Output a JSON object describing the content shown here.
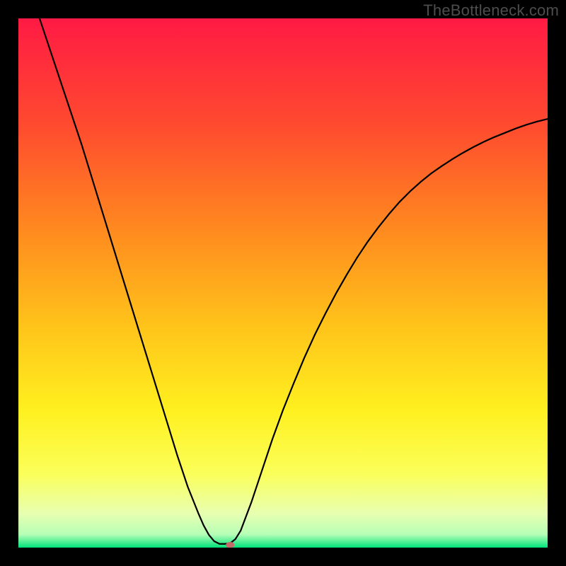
{
  "watermark": "TheBottleneck.com",
  "chart_data": {
    "type": "line",
    "title": "",
    "xlabel": "",
    "ylabel": "",
    "xlim": [
      0,
      100
    ],
    "ylim": [
      0,
      100
    ],
    "grid": false,
    "legend": false,
    "background_gradient_stops": [
      {
        "pos": 0.0,
        "color": "#ff1a44"
      },
      {
        "pos": 0.2,
        "color": "#ff4a2f"
      },
      {
        "pos": 0.4,
        "color": "#ff8a1f"
      },
      {
        "pos": 0.58,
        "color": "#ffc31a"
      },
      {
        "pos": 0.74,
        "color": "#fff01f"
      },
      {
        "pos": 0.86,
        "color": "#fbff5a"
      },
      {
        "pos": 0.935,
        "color": "#e8ffb0"
      },
      {
        "pos": 0.975,
        "color": "#b6ffb6"
      },
      {
        "pos": 1.0,
        "color": "#00e27a"
      }
    ],
    "curve": [
      {
        "x": 4.0,
        "y": 100.0
      },
      {
        "x": 6.0,
        "y": 94.0
      },
      {
        "x": 8.0,
        "y": 88.0
      },
      {
        "x": 10.0,
        "y": 82.0
      },
      {
        "x": 12.0,
        "y": 76.0
      },
      {
        "x": 14.0,
        "y": 69.5
      },
      {
        "x": 16.0,
        "y": 63.0
      },
      {
        "x": 18.0,
        "y": 56.5
      },
      {
        "x": 20.0,
        "y": 50.0
      },
      {
        "x": 22.0,
        "y": 43.5
      },
      {
        "x": 24.0,
        "y": 37.0
      },
      {
        "x": 26.0,
        "y": 30.5
      },
      {
        "x": 28.0,
        "y": 24.0
      },
      {
        "x": 30.0,
        "y": 17.5
      },
      {
        "x": 32.0,
        "y": 11.5
      },
      {
        "x": 34.0,
        "y": 6.5
      },
      {
        "x": 35.0,
        "y": 4.2
      },
      {
        "x": 36.0,
        "y": 2.4
      },
      {
        "x": 37.0,
        "y": 1.2
      },
      {
        "x": 38.0,
        "y": 0.7
      },
      {
        "x": 39.0,
        "y": 0.7
      },
      {
        "x": 40.0,
        "y": 0.8
      },
      {
        "x": 41.0,
        "y": 1.6
      },
      {
        "x": 42.0,
        "y": 3.2
      },
      {
        "x": 44.0,
        "y": 8.5
      },
      {
        "x": 46.0,
        "y": 14.5
      },
      {
        "x": 48.0,
        "y": 20.5
      },
      {
        "x": 50.0,
        "y": 26.0
      },
      {
        "x": 52.0,
        "y": 31.0
      },
      {
        "x": 54.0,
        "y": 35.8
      },
      {
        "x": 56.0,
        "y": 40.2
      },
      {
        "x": 58.0,
        "y": 44.2
      },
      {
        "x": 60.0,
        "y": 48.0
      },
      {
        "x": 62.0,
        "y": 51.5
      },
      {
        "x": 64.0,
        "y": 54.8
      },
      {
        "x": 66.0,
        "y": 57.8
      },
      {
        "x": 68.0,
        "y": 60.5
      },
      {
        "x": 70.0,
        "y": 63.0
      },
      {
        "x": 72.0,
        "y": 65.3
      },
      {
        "x": 74.0,
        "y": 67.3
      },
      {
        "x": 76.0,
        "y": 69.1
      },
      {
        "x": 78.0,
        "y": 70.7
      },
      {
        "x": 80.0,
        "y": 72.1
      },
      {
        "x": 82.0,
        "y": 73.4
      },
      {
        "x": 84.0,
        "y": 74.6
      },
      {
        "x": 86.0,
        "y": 75.7
      },
      {
        "x": 88.0,
        "y": 76.7
      },
      {
        "x": 90.0,
        "y": 77.6
      },
      {
        "x": 92.0,
        "y": 78.4
      },
      {
        "x": 94.0,
        "y": 79.2
      },
      {
        "x": 96.0,
        "y": 79.9
      },
      {
        "x": 98.0,
        "y": 80.5
      },
      {
        "x": 100.0,
        "y": 81.0
      }
    ],
    "marker": {
      "x": 40.0,
      "y": 0.5,
      "color": "#c76a6a"
    }
  }
}
